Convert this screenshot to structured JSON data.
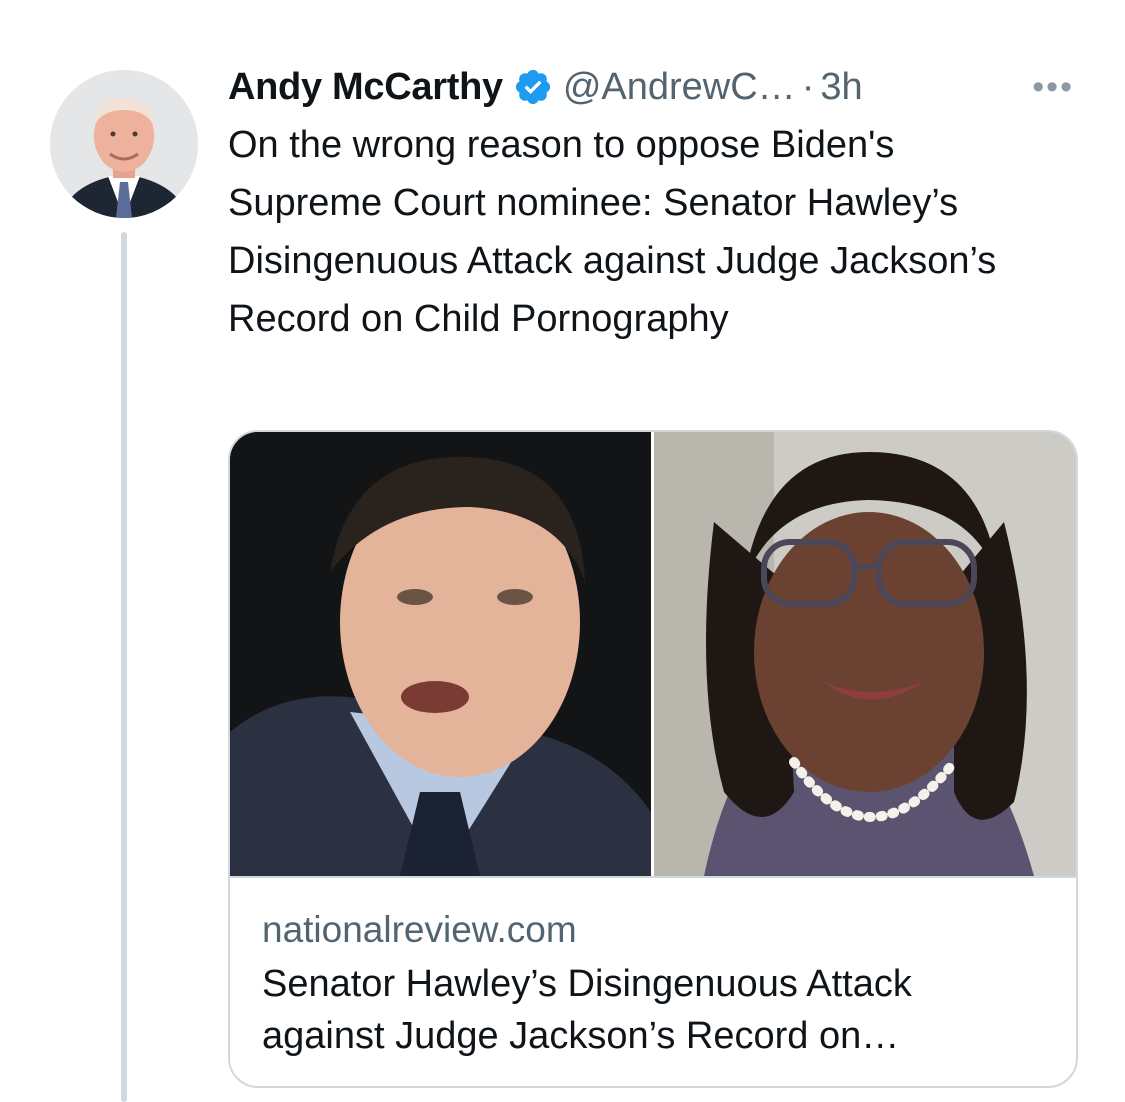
{
  "tweet": {
    "author_name": "Andy McCarthy",
    "handle": "@AndrewC…",
    "separator": "·",
    "time": "3h",
    "more_label": "•••",
    "text": "On the wrong reason to oppose Biden's Supreme Court nominee: Senator Hawley’s Disingenuous Attack against Judge Jackson’s Record on Child Pornography"
  },
  "card": {
    "domain": "nationalreview.com",
    "title": "Senator Hawley’s Disingenuous Attack against Judge Jackson’s Record on…"
  },
  "colors": {
    "verified": "#1d9bf0",
    "secondary_text": "#536471",
    "border": "#cfd9de"
  },
  "icons": {
    "verified": "verified-badge-icon",
    "more": "more-options-icon"
  }
}
